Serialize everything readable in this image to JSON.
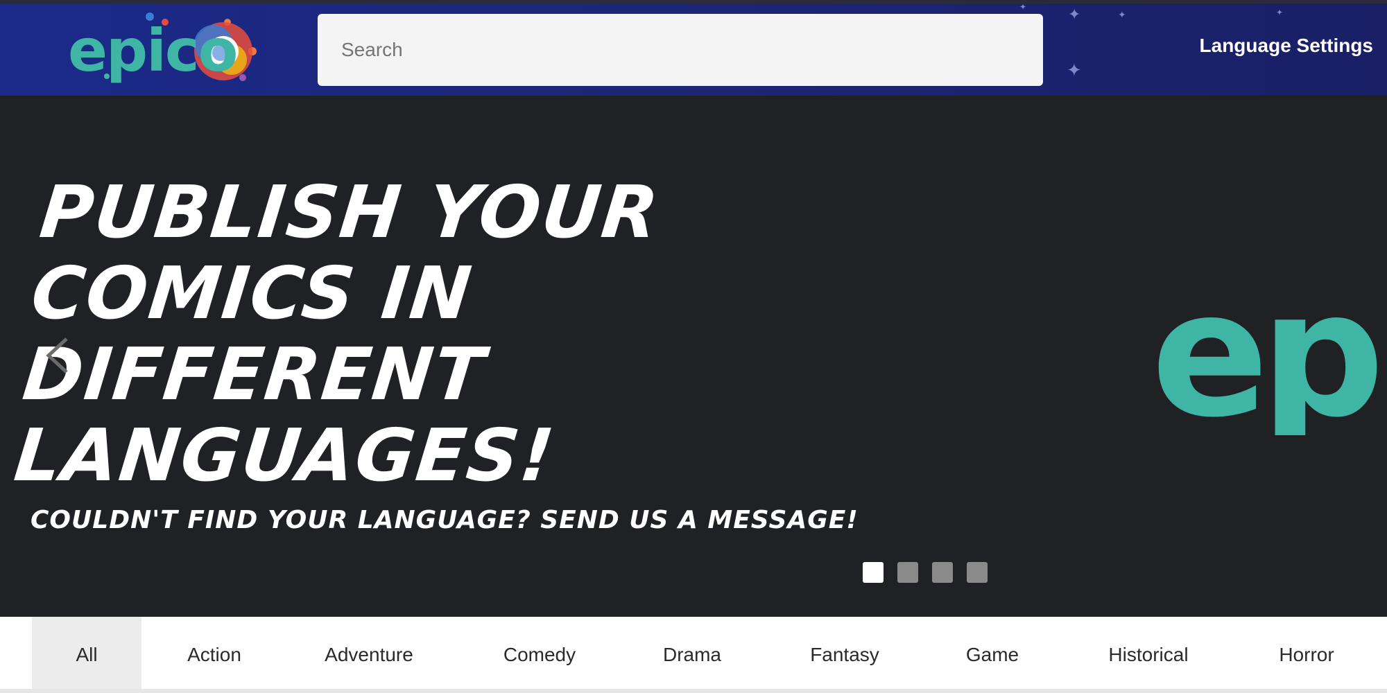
{
  "header": {
    "logo_text": "epico",
    "search_placeholder": "Search",
    "language_settings_label": "Language Settings"
  },
  "hero": {
    "title_lines": [
      "Publish your",
      "comics in",
      "different",
      "languages!"
    ],
    "subtitle": "Couldn't find your language? Send us a message!",
    "slide_count": 4,
    "active_slide": 1,
    "logo_text": "ep"
  },
  "categories": [
    {
      "label": "All",
      "active": true
    },
    {
      "label": "Action",
      "active": false
    },
    {
      "label": "Adventure",
      "active": false
    },
    {
      "label": "Comedy",
      "active": false
    },
    {
      "label": "Drama",
      "active": false
    },
    {
      "label": "Fantasy",
      "active": false
    },
    {
      "label": "Game",
      "active": false
    },
    {
      "label": "Historical",
      "active": false
    },
    {
      "label": "Horror",
      "active": false
    }
  ],
  "colors": {
    "header_bg": "#1b2a8a",
    "hero_bg": "#202124",
    "logo_teal": "#3fb5a6",
    "logo_orange": "#ee7742",
    "logo_purple": "#9b59b6",
    "logo_blue": "#3a7bd5",
    "logo_red": "#e74c3c"
  },
  "icons": {
    "prev": "chevron-left-icon",
    "stars": "sparkle-star-icon"
  }
}
